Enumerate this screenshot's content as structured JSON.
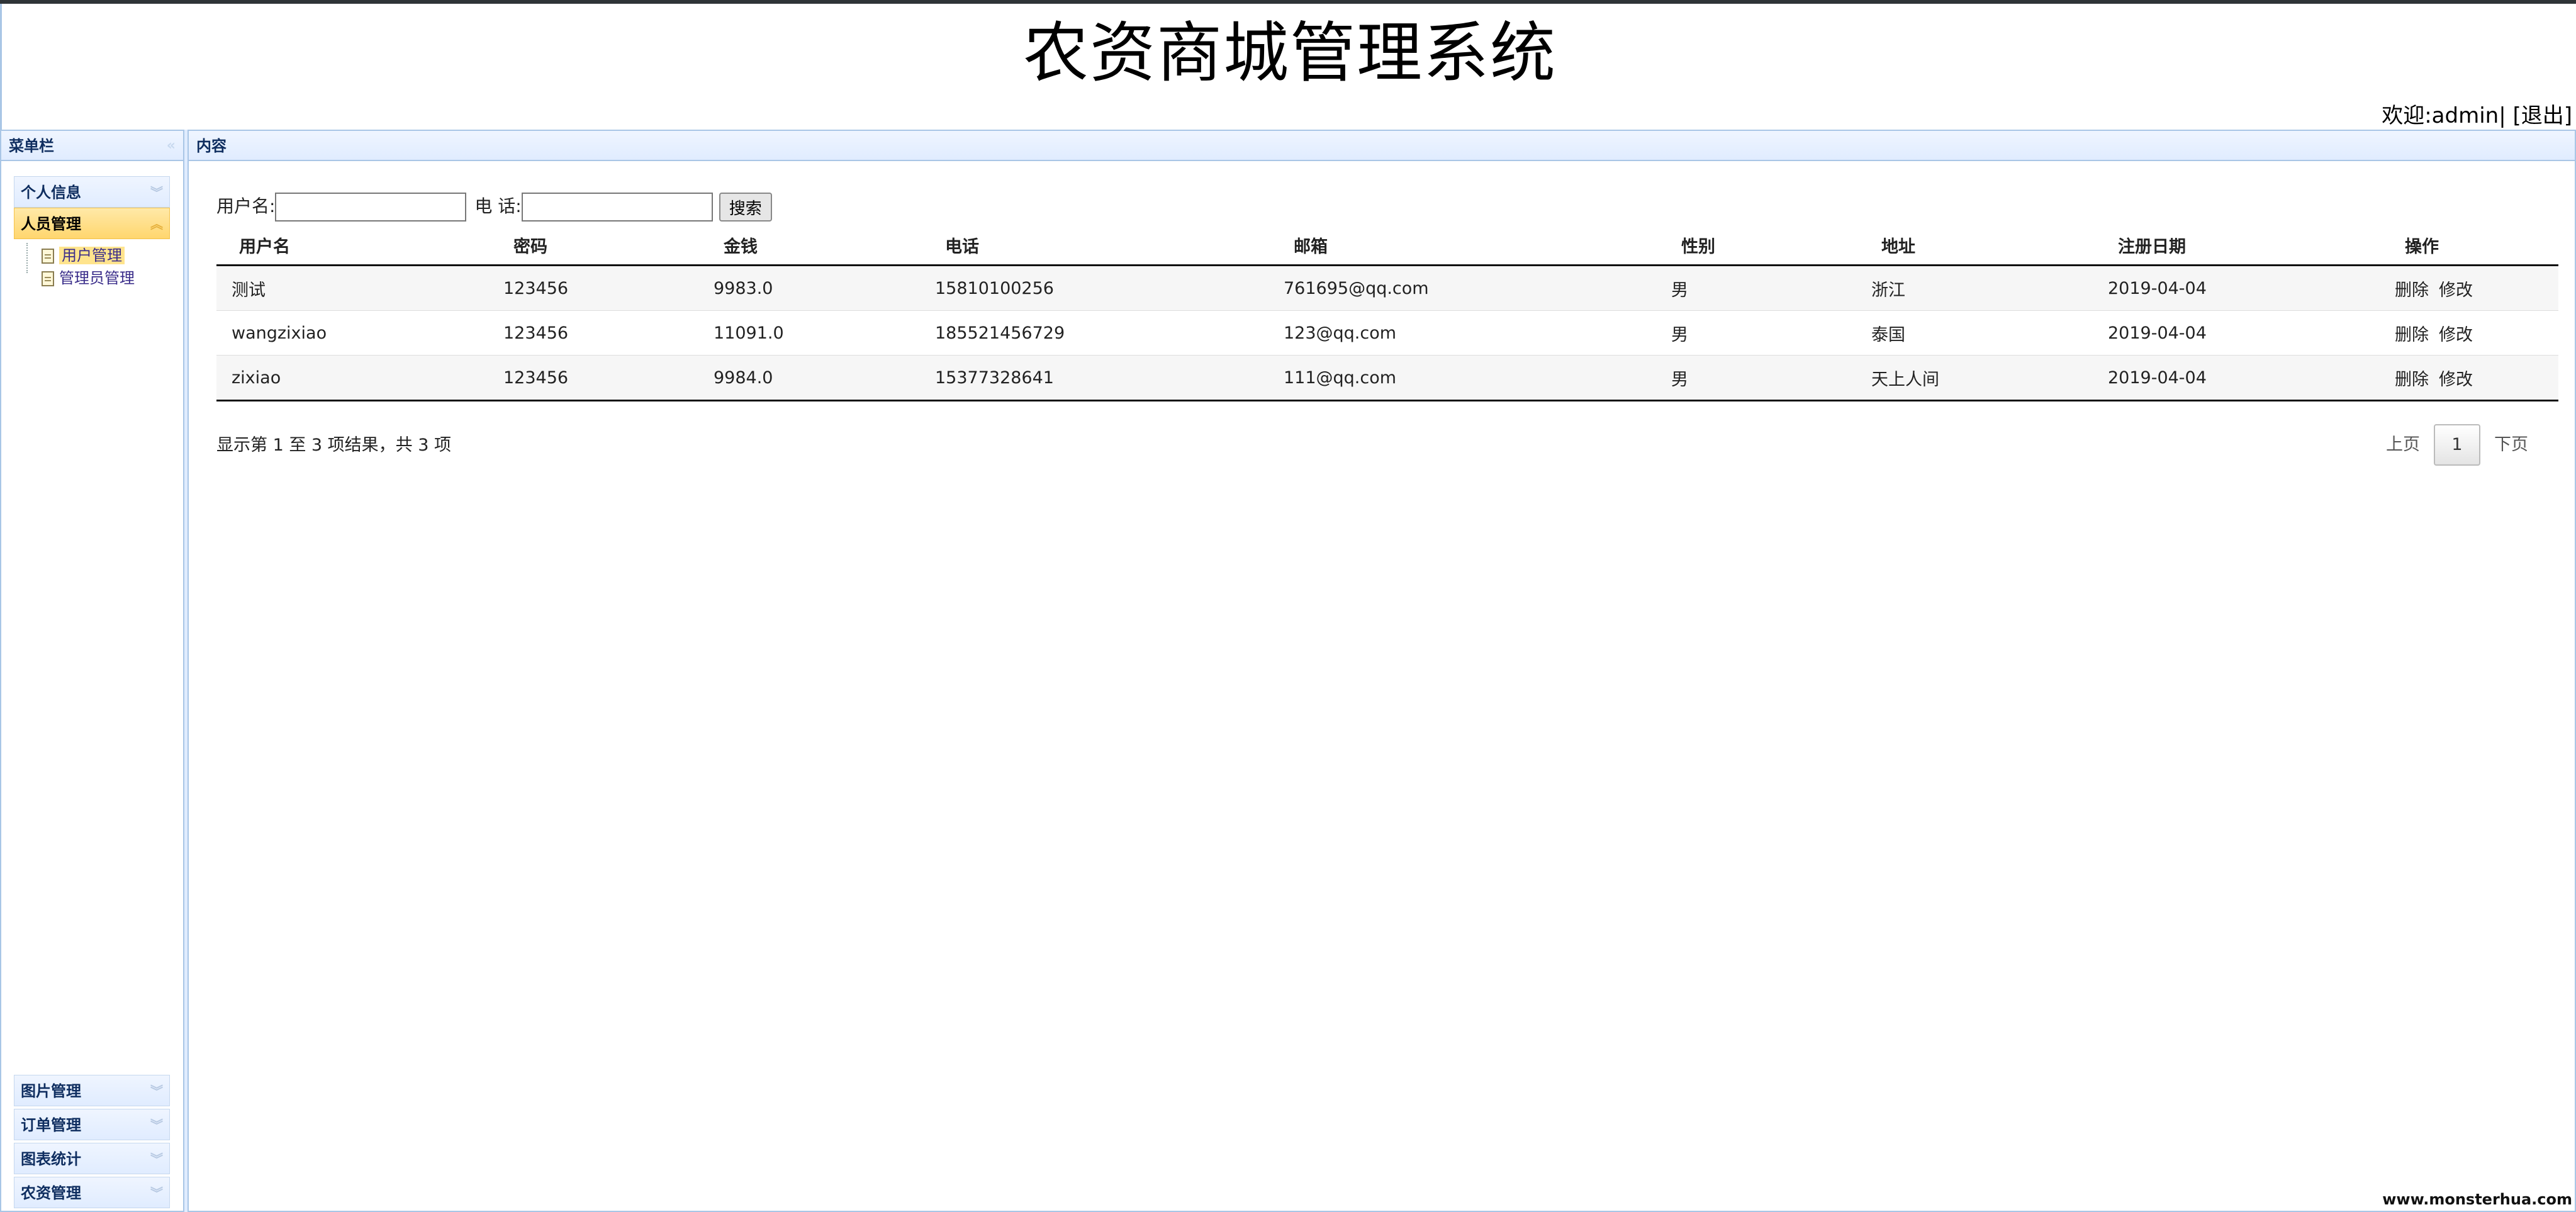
{
  "header": {
    "title": "农资商城管理系统",
    "welcome": "欢迎:admin|",
    "logout": "[退出]"
  },
  "sidebar": {
    "title": "菜单栏",
    "top_items": [
      {
        "label": "个人信息",
        "active": false
      },
      {
        "label": "人员管理",
        "active": true
      }
    ],
    "tree": [
      {
        "label": "用户管理",
        "selected": true
      },
      {
        "label": "管理员管理",
        "selected": false
      }
    ],
    "bottom_items": [
      {
        "label": "图片管理"
      },
      {
        "label": "订单管理"
      },
      {
        "label": "图表统计"
      },
      {
        "label": "农资管理"
      }
    ]
  },
  "content": {
    "title": "内容",
    "search": {
      "username_label": "用户名:",
      "username_value": "",
      "phone_label": "电 话:",
      "phone_value": "",
      "button_label": "搜索"
    },
    "table": {
      "columns": [
        "用户名",
        "密码",
        "金钱",
        "电话",
        "邮箱",
        "性别",
        "地址",
        "注册日期",
        "操作"
      ],
      "rows": [
        [
          "测试",
          "123456",
          "9983.0",
          "15810100256",
          "761695@qq.com",
          "男",
          "浙江",
          "2019-04-04"
        ],
        [
          "wangzixiao",
          "123456",
          "11091.0",
          "185521456729",
          "123@qq.com",
          "男",
          "泰国",
          "2019-04-04"
        ],
        [
          "zixiao",
          "123456",
          "9984.0",
          "15377328641",
          "111@qq.com",
          "男",
          "天上人间",
          "2019-04-04"
        ]
      ],
      "actions": {
        "delete": "删除",
        "edit": "修改"
      }
    },
    "pager": {
      "info": "显示第 1 至 3 项结果，共 3 项",
      "prev": "上页",
      "current": "1",
      "next": "下页"
    }
  },
  "watermark": "www.monsterhua.com"
}
